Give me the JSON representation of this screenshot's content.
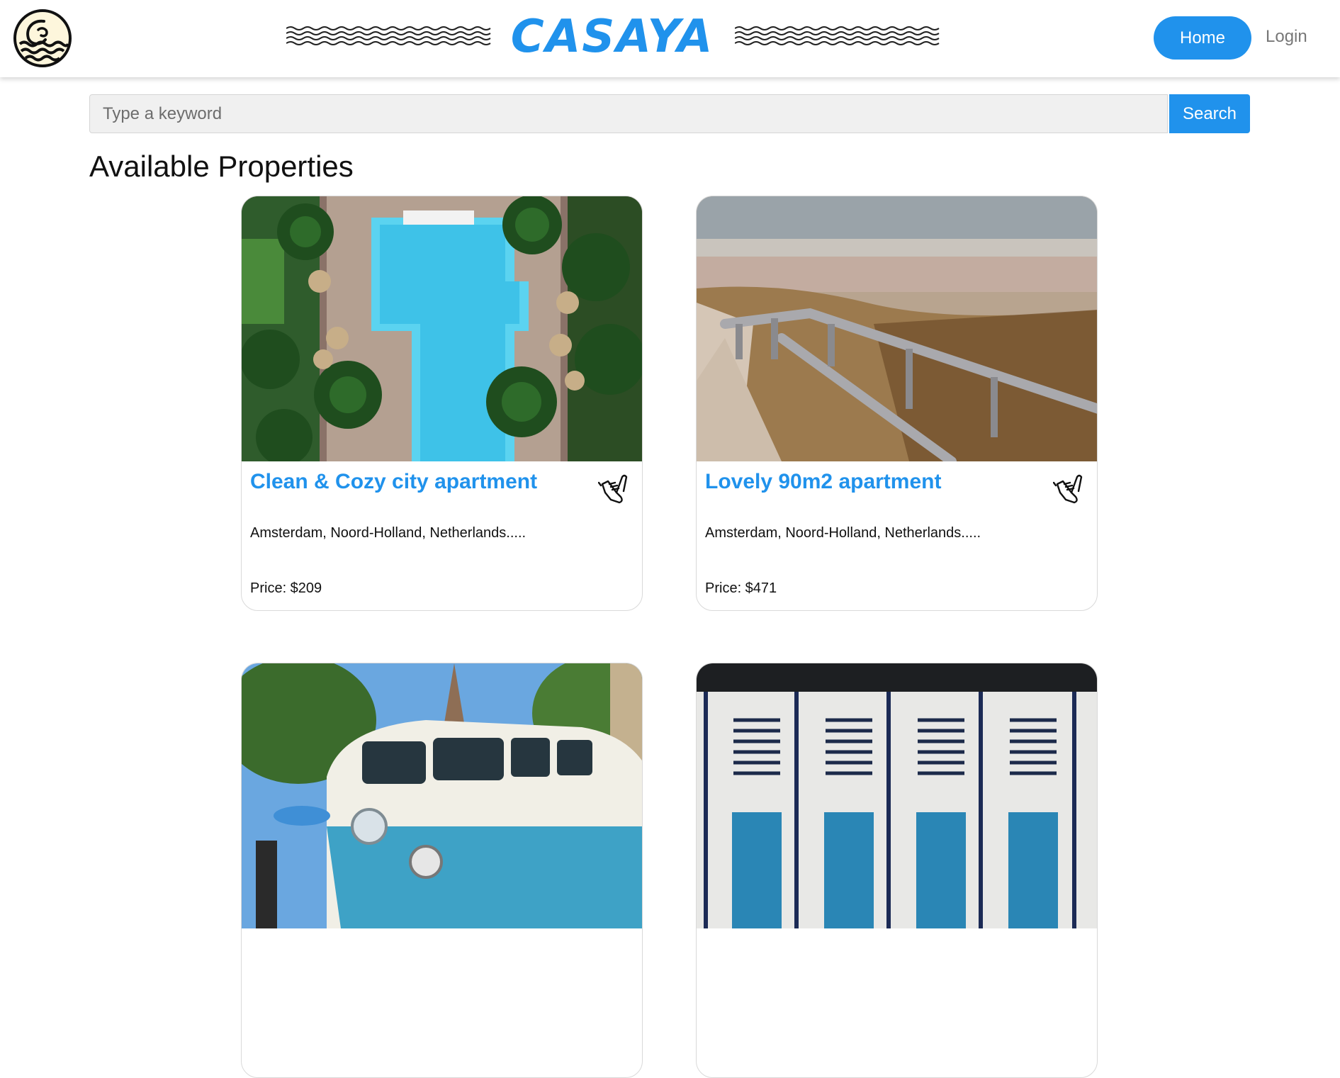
{
  "header": {
    "brand": "CASAYA",
    "nav": {
      "home_label": "Home",
      "login_label": "Login"
    },
    "colors": {
      "accent": "#2092ec"
    }
  },
  "search": {
    "placeholder": "Type a keyword",
    "button_label": "Search"
  },
  "page_title": "Available Properties",
  "properties": [
    {
      "title": "Clean & Cozy city apartment",
      "location": "Amsterdam, Noord-Holland, Netherlands.....",
      "price": "Price: $209",
      "image": "pool-aerial",
      "favorite_icon": "shaka-hand-icon"
    },
    {
      "title": "Lovely 90m2 apartment",
      "location": "Amsterdam, Noord-Holland, Netherlands.....",
      "price": "Price: $471",
      "image": "beach-boardwalk",
      "favorite_icon": "shaka-hand-icon"
    },
    {
      "image": "vw-van"
    },
    {
      "image": "beach-cabins"
    }
  ]
}
